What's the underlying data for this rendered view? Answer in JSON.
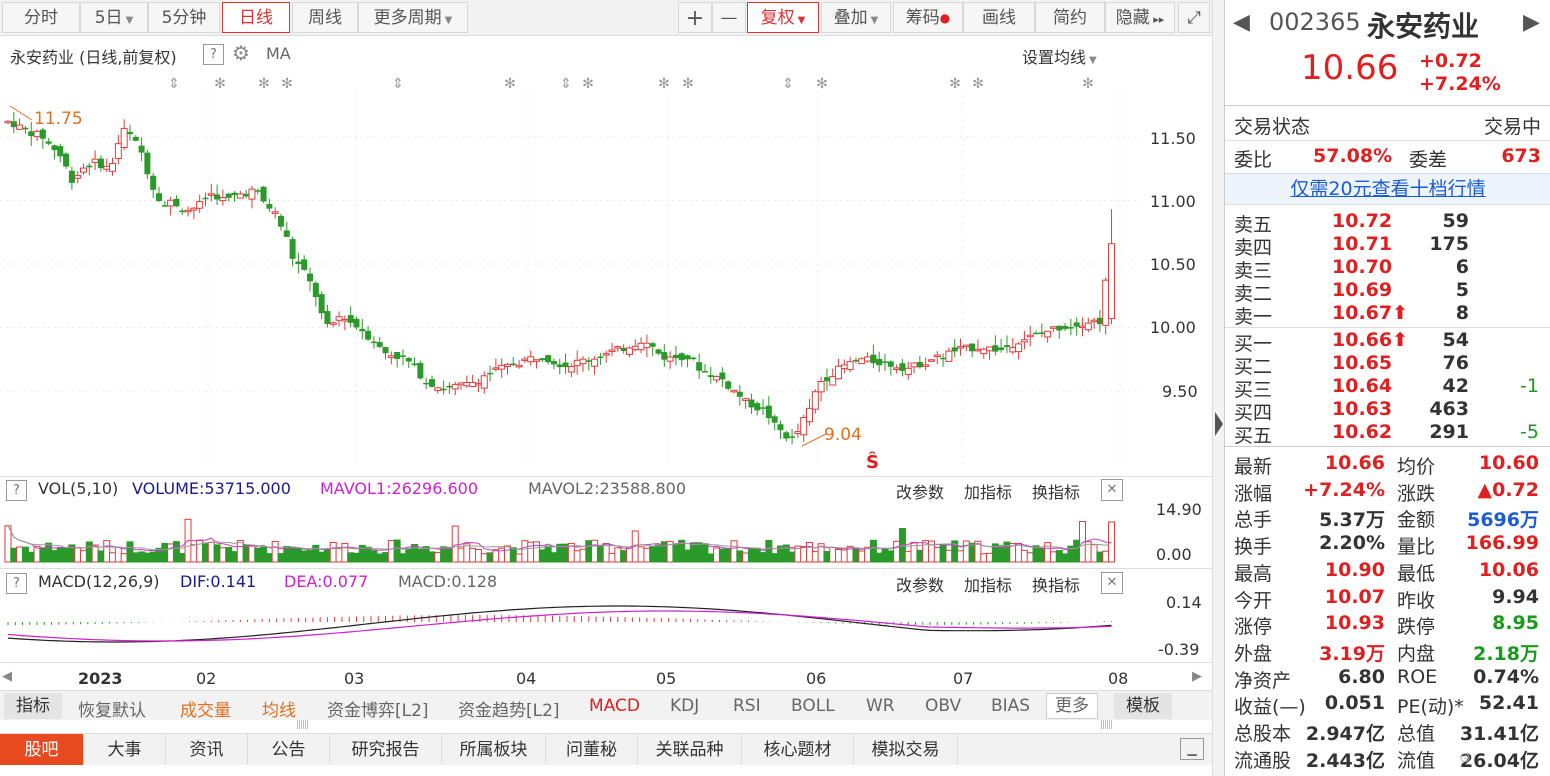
{
  "toolbar": {
    "tabs": [
      "分时",
      "5日",
      "5分钟",
      "日线",
      "周线",
      "更多周期"
    ],
    "plus": "+",
    "minus": "—",
    "fuquan": "复权",
    "overlay": "叠加",
    "chips": "筹码",
    "draw": "画线",
    "simple": "简约",
    "hide": "隐藏"
  },
  "chart_header": {
    "title": "永安药业 (日线,前复权)",
    "ma": "MA",
    "setting": "设置均线"
  },
  "price_axis": {
    "ticks": [
      "11.50",
      "11.00",
      "10.50",
      "10.00",
      "9.50"
    ]
  },
  "annotations": {
    "high": "11.75",
    "low": "9.04"
  },
  "vol": {
    "title": "VOL(5,10)",
    "volume": "VOLUME:53715.000",
    "mavol1": "MAVOL1:26296.600",
    "mavol2": "MAVOL2:23588.800",
    "ticks": [
      "14.90",
      "0.00"
    ],
    "btns": [
      "改参数",
      "加指标",
      "换指标"
    ]
  },
  "macd": {
    "title": "MACD(12,26,9)",
    "dif": "DIF:0.141",
    "dea": "DEA:0.077",
    "macd": "MACD:0.128",
    "ticks": [
      "0.14",
      "-0.39"
    ],
    "btns": [
      "改参数",
      "加指标",
      "换指标"
    ]
  },
  "xaxis": {
    "labels": [
      "2023",
      "02",
      "03",
      "04",
      "05",
      "06",
      "07",
      "08"
    ]
  },
  "indicator_tabs": [
    "指标",
    "恢复默认",
    "成交量",
    "均线",
    "资金博弈[L2]",
    "资金趋势[L2]",
    "MACD",
    "KDJ",
    "RSI",
    "BOLL",
    "WR",
    "OBV",
    "BIAS",
    "更多",
    "模板"
  ],
  "bottom_tabs": [
    "股吧",
    "大事",
    "资讯",
    "公告",
    "研究报告",
    "所属板块",
    "问董秘",
    "关联品种",
    "核心题材",
    "模拟交易"
  ],
  "quote": {
    "code": "002365",
    "name": "永安药业",
    "price": "10.66",
    "change": "+0.72",
    "change_pct": "+7.24%",
    "status_label": "交易状态",
    "status_value": "交易中",
    "weibi_label": "委比",
    "weibi": "57.08%",
    "weicha_label": "委差",
    "weicha": "673",
    "link": "仅需20元查看十档行情"
  },
  "asks": [
    {
      "label": "卖五",
      "price": "10.72",
      "vol": "59"
    },
    {
      "label": "卖四",
      "price": "10.71",
      "vol": "175"
    },
    {
      "label": "卖三",
      "price": "10.70",
      "vol": "6"
    },
    {
      "label": "卖二",
      "price": "10.69",
      "vol": "5"
    },
    {
      "label": "卖一",
      "price": "10.67⬆",
      "vol": "8"
    }
  ],
  "bids": [
    {
      "label": "买一",
      "price": "10.66⬆",
      "vol": "54",
      "chg": ""
    },
    {
      "label": "买二",
      "price": "10.65",
      "vol": "76",
      "chg": ""
    },
    {
      "label": "买三",
      "price": "10.64",
      "vol": "42",
      "chg": "-1"
    },
    {
      "label": "买四",
      "price": "10.63",
      "vol": "463",
      "chg": ""
    },
    {
      "label": "买五",
      "price": "10.62",
      "vol": "291",
      "chg": "-5"
    }
  ],
  "stats": [
    {
      "l1": "最新",
      "v1": "10.66",
      "c1": "red",
      "l2": "均价",
      "v2": "10.60",
      "c2": "red"
    },
    {
      "l1": "涨幅",
      "v1": "+7.24%",
      "c1": "red",
      "l2": "涨跌",
      "v2": "▲0.72",
      "c2": "red"
    },
    {
      "l1": "总手",
      "v1": "5.37万",
      "c1": "",
      "l2": "金额",
      "v2": "5696万",
      "c2": "blu"
    },
    {
      "l1": "换手",
      "v1": "2.20%",
      "c1": "",
      "l2": "量比",
      "v2": "166.99",
      "c2": "red"
    },
    {
      "l1": "最高",
      "v1": "10.90",
      "c1": "red",
      "l2": "最低",
      "v2": "10.06",
      "c2": "red"
    },
    {
      "l1": "今开",
      "v1": "10.07",
      "c1": "red",
      "l2": "昨收",
      "v2": "9.94",
      "c2": ""
    },
    {
      "l1": "涨停",
      "v1": "10.93",
      "c1": "red",
      "l2": "跌停",
      "v2": "8.95",
      "c2": "grn"
    },
    {
      "l1": "外盘",
      "v1": "3.19万",
      "c1": "red",
      "l2": "内盘",
      "v2": "2.18万",
      "c2": "grn"
    },
    {
      "l1": "净资产",
      "v1": "6.80",
      "c1": "",
      "l2": "ROE",
      "v2": "0.74%",
      "c2": ""
    },
    {
      "l1": "收益(—)",
      "v1": "0.051",
      "c1": "",
      "l2": "PE(动)*",
      "v2": "52.41",
      "c2": ""
    },
    {
      "l1": "总股本",
      "v1": "2.947亿",
      "c1": "",
      "l2": "总值",
      "v2": "31.41亿",
      "c2": ""
    },
    {
      "l1": "流通股",
      "v1": "2.443亿",
      "c1": "",
      "l2": "流值",
      "v2": "26.04亿",
      "c2": ""
    }
  ],
  "chart_data": {
    "type": "candlestick",
    "price_ticks": [
      11.5,
      11.0,
      10.5,
      10.0,
      9.5
    ],
    "period_high": 11.75,
    "period_low": 9.04,
    "last_close": 10.66,
    "x_labels": [
      "2023",
      "02",
      "03",
      "04",
      "05",
      "06",
      "07",
      "08"
    ]
  }
}
